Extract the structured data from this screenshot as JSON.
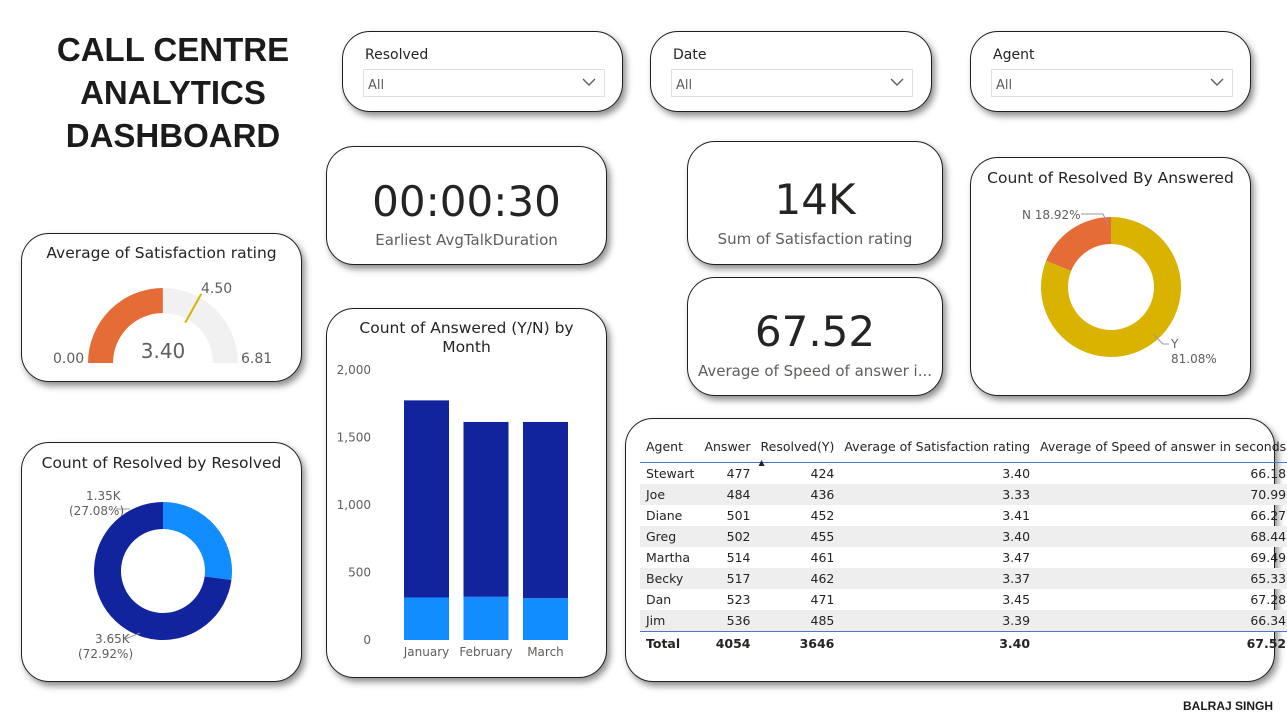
{
  "title_lines": [
    "CALL CENTRE",
    "ANALYTICS",
    "DASHBOARD"
  ],
  "filters": [
    {
      "label": "Resolved",
      "value": "All"
    },
    {
      "label": "Date",
      "value": "All"
    },
    {
      "label": "Agent",
      "value": "All"
    }
  ],
  "kpis": {
    "talk_duration": {
      "value": "00:00:30",
      "label": "Earliest AvgTalkDuration"
    },
    "satisfaction_sum": {
      "value": "14K",
      "label": "Sum of Satisfaction rating"
    },
    "speed_avg": {
      "value": "67.52",
      "label": "Average of Speed of answer i..."
    }
  },
  "gauge": {
    "title": "Average of Satisfaction rating",
    "value_label": "3.40",
    "min_label": "0.00",
    "max_label": "6.81",
    "target_label": "4.50",
    "value": 3.4,
    "min": 0,
    "max": 6.81,
    "target": 4.5,
    "fill_color": "#E66C37",
    "track_color": "#F1F1F1",
    "target_color": "#D9B300"
  },
  "donut_resolved": {
    "title": "Count of Resolved by Resolved",
    "slices": [
      {
        "value": 1350,
        "pct": 27.08,
        "label1": "1.35K",
        "label2": "(27.08%)",
        "color": "#118DFF"
      },
      {
        "value": 3650,
        "pct": 72.92,
        "label1": "3.65K",
        "label2": "(72.92%)",
        "color": "#12239E"
      }
    ]
  },
  "donut_answered": {
    "title": "Count of Resolved By Answered",
    "slices": [
      {
        "name": "N",
        "pct": 18.92,
        "label1": "N 18.92%",
        "color": "#E66C37"
      },
      {
        "name": "Y",
        "pct": 81.08,
        "label1": "Y",
        "label2": "81.08%",
        "color": "#D9B300"
      }
    ]
  },
  "chart_data": {
    "type": "bar",
    "title": "Count of Answered (Y/N) by Month",
    "categories": [
      "January",
      "February",
      "March"
    ],
    "series": [
      {
        "values": [
          315,
          320,
          310
        ],
        "color": "#118DFF"
      },
      {
        "values": [
          1460,
          1295,
          1305
        ],
        "color": "#12239E"
      }
    ],
    "yticks": [
      "0",
      "500",
      "1,000",
      "1,500",
      "2,000"
    ],
    "ylim": [
      0,
      2000
    ],
    "stacked": true
  },
  "table": {
    "headers": [
      "Agent",
      "Answer",
      "Resolved(Y)",
      "Average of Satisfaction rating",
      "Average of Speed of answer in seconds"
    ],
    "sort_indicator": "▲",
    "rows": [
      [
        "Stewart",
        "477",
        "424",
        "3.40",
        "66.18"
      ],
      [
        "Joe",
        "484",
        "436",
        "3.33",
        "70.99"
      ],
      [
        "Diane",
        "501",
        "452",
        "3.41",
        "66.27"
      ],
      [
        "Greg",
        "502",
        "455",
        "3.40",
        "68.44"
      ],
      [
        "Martha",
        "514",
        "461",
        "3.47",
        "69.49"
      ],
      [
        "Becky",
        "517",
        "462",
        "3.37",
        "65.33"
      ],
      [
        "Dan",
        "523",
        "471",
        "3.45",
        "67.28"
      ],
      [
        "Jim",
        "536",
        "485",
        "3.39",
        "66.34"
      ]
    ],
    "total": [
      "Total",
      "4054",
      "3646",
      "3.40",
      "67.52"
    ]
  },
  "credit": "BALRAJ SINGH"
}
